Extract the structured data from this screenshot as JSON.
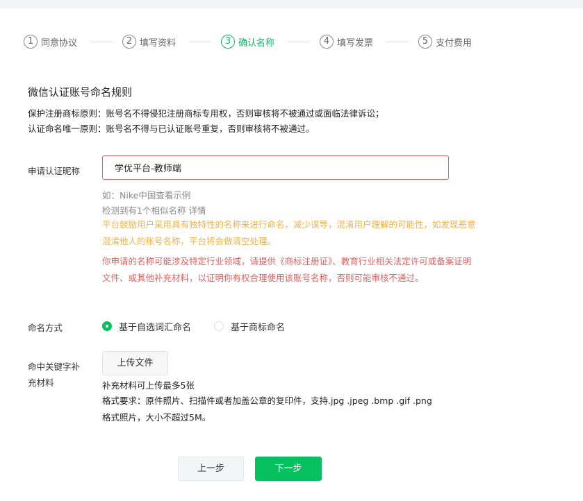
{
  "steps": [
    {
      "num": "1",
      "label": "同意协议"
    },
    {
      "num": "2",
      "label": "填写资料"
    },
    {
      "num": "3",
      "label": "确认名称"
    },
    {
      "num": "4",
      "label": "填写发票"
    },
    {
      "num": "5",
      "label": "支付费用"
    }
  ],
  "active_step": 3,
  "rules": {
    "title": "微信认证账号命名规则",
    "line1": "保护注册商标原则：账号名不得侵犯注册商标专用权，否则审核将不被通过或面临法律诉讼；",
    "line2": "认证命名唯一原则：账号名不得与已认证账号重复，否则审核将不被通过。"
  },
  "nickname": {
    "label": "申请认证昵称",
    "value": "学优平台-教师端",
    "example_prefix": "如：",
    "example_link": "Nike中国查看示例",
    "similar_text": "检测到有1个相似名称",
    "similar_link": "详情",
    "orange_warning": "平台鼓励用户采用具有独特性的名称来进行命名，减少误导，混淆用户理解的可能性，如发现恶意混淆他人的账号名称，平台将会做清空处理。",
    "red_warning": "你申请的名称可能涉及特定行业领域，请提供《商标注册证》、教育行业相关法定许可或备案证明文件、或其他补充材料，以证明你有权合理使用该账号名称，否则可能审核不通过。"
  },
  "naming_method": {
    "label": "命名方式",
    "options": [
      "基于自选词汇命名",
      "基于商标命名"
    ],
    "selected": "基于自选词汇命名"
  },
  "supplement": {
    "label_line1": "命中关键字补",
    "label_line2": "充材料",
    "upload_label": "上传文件",
    "note1": "补充材料可上传最多5张",
    "note2": "格式要求：原件照片、扫描件或者加盖公章的复印件，支持.jpg .jpeg .bmp .gif .png",
    "note3": "格式照片，大小不超过5M。"
  },
  "buttons": {
    "prev": "上一步",
    "next": "下一步"
  },
  "colors": {
    "accent": "#07c160",
    "warning_orange": "#f0b24a",
    "warning_red": "#e0615f"
  }
}
